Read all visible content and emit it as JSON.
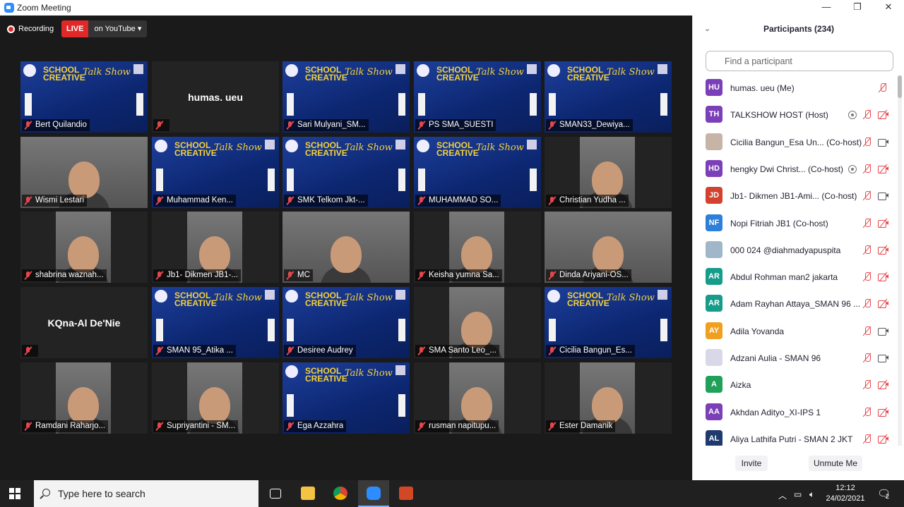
{
  "window": {
    "title": "Zoom Meeting",
    "minimize": "—",
    "maximize": "❐",
    "close": "✕"
  },
  "recording": {
    "label": "Recording"
  },
  "live": {
    "badge": "LIVE",
    "target": "on YouTube ▾"
  },
  "tiles": [
    {
      "name": "Bert Quilandio",
      "kind": "banner"
    },
    {
      "name": "",
      "kind": "dark",
      "center": "humas. ueu"
    },
    {
      "name": "Sari Mulyani_SM...",
      "kind": "banner"
    },
    {
      "name": "PS SMA_SUESTI",
      "kind": "banner"
    },
    {
      "name": "SMAN33_Dewiya...",
      "kind": "banner"
    },
    {
      "name": "Wismi Lestari",
      "kind": "cam"
    },
    {
      "name": "Muhammad Ken...",
      "kind": "banner"
    },
    {
      "name": "SMK Telkom Jkt-...",
      "kind": "banner"
    },
    {
      "name": "MUHAMMAD SO...",
      "kind": "banner"
    },
    {
      "name": "Christian Yudha ...",
      "kind": "camnarrow"
    },
    {
      "name": "shabrina waznah...",
      "kind": "camnarrow"
    },
    {
      "name": "Jb1- Dikmen JB1-...",
      "kind": "camnarrow"
    },
    {
      "name": "MC",
      "kind": "cam",
      "active": true
    },
    {
      "name": "Keisha yumna Sa...",
      "kind": "camnarrow"
    },
    {
      "name": "Dinda Ariyani-OS...",
      "kind": "cam"
    },
    {
      "name": "",
      "kind": "dark",
      "center": "KQna-Al De'Nie"
    },
    {
      "name": "SMAN 95_Atika ...",
      "kind": "banner"
    },
    {
      "name": "Desiree Audrey",
      "kind": "banner"
    },
    {
      "name": "SMA Santo Leo_...",
      "kind": "camnarrow"
    },
    {
      "name": "Cicilia Bangun_Es...",
      "kind": "banner"
    },
    {
      "name": "Ramdani Raharjo...",
      "kind": "camnarrow"
    },
    {
      "name": "Supriyantini - SM...",
      "kind": "camnarrow"
    },
    {
      "name": "Ega Azzahra",
      "kind": "banner"
    },
    {
      "name": "rusman napitupu...",
      "kind": "camnarrow"
    },
    {
      "name": "Ester Damanik",
      "kind": "camnarrow"
    }
  ],
  "panel": {
    "title": "Participants (234)",
    "collapse_icon": "⌄",
    "search_placeholder": "Find a participant",
    "participants": [
      {
        "initials": "HU",
        "name": "humas. ueu (Me)",
        "color": "#7b3fb8",
        "rec": false,
        "cam": "none"
      },
      {
        "initials": "TH",
        "name": "TALKSHOW HOST (Host)",
        "color": "#7b3fb8",
        "rec": true,
        "cam": "off"
      },
      {
        "initials": "",
        "name": "Cicilia Bangun_Esa Un... (Co-host)",
        "color": "#c8b4a6",
        "rec": false,
        "cam": "on"
      },
      {
        "initials": "HD",
        "name": "hengky Dwi Christ... (Co-host)",
        "color": "#7b3fb8",
        "rec": true,
        "cam": "off"
      },
      {
        "initials": "JD",
        "name": "Jb1- Dikmen JB1-Ami... (Co-host)",
        "color": "#d2422e",
        "rec": false,
        "cam": "on"
      },
      {
        "initials": "NF",
        "name": "Nopi Fitriah JB1 (Co-host)",
        "color": "#2e7fd8",
        "rec": false,
        "cam": "off"
      },
      {
        "initials": "",
        "name": "000 024 @diahmadyapuspita",
        "color": "#9fb7c9",
        "rec": false,
        "cam": "off"
      },
      {
        "initials": "AR",
        "name": "Abdul Rohman man2 jakarta",
        "color": "#169c8a",
        "rec": false,
        "cam": "off"
      },
      {
        "initials": "AR",
        "name": "Adam Rayhan Attaya_SMAN 96 ...",
        "color": "#169c8a",
        "rec": false,
        "cam": "off"
      },
      {
        "initials": "AY",
        "name": "Adila Yovanda",
        "color": "#f0a020",
        "rec": false,
        "cam": "on"
      },
      {
        "initials": "",
        "name": "Adzani Aulia - SMAN 96",
        "color": "#d8d8e8",
        "rec": false,
        "cam": "on"
      },
      {
        "initials": "A",
        "name": "Aizka",
        "color": "#21a05a",
        "rec": false,
        "cam": "off"
      },
      {
        "initials": "AA",
        "name": "Akhdan Adityo_XI-IPS 1",
        "color": "#7b3fb8",
        "rec": false,
        "cam": "off"
      },
      {
        "initials": "AL",
        "name": "Aliya Lathifa Putri - SMAN 2 JKT",
        "color": "#1f3a6e",
        "rec": false,
        "cam": "off"
      }
    ],
    "invite_label": "Invite",
    "unmute_label": "Unmute Me"
  },
  "taskbar": {
    "search_placeholder": "Type here to search",
    "time": "12:12",
    "date": "24/02/2021",
    "notification_count": "2"
  }
}
